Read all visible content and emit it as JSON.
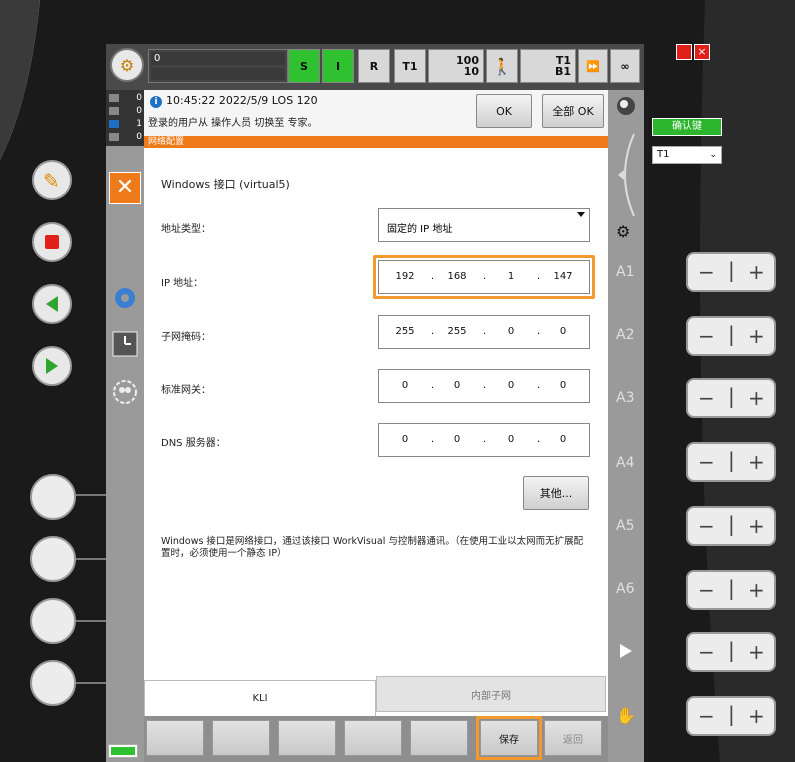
{
  "colors": {
    "accent": "#ef7a1a",
    "highlight": "#f39a2e",
    "status_green": "#2fc12f",
    "confirm_green": "#2db52d",
    "close_red": "#e0201a"
  },
  "status_bar": {
    "program_counter": "0",
    "s_label": "S",
    "i_label": "I",
    "r_label": "R",
    "mode_label": "T1",
    "override_top": "100",
    "override_bottom": "10",
    "tool_top": "T1",
    "tool_bottom": "B1",
    "infinity": "∞"
  },
  "message_counts": [
    "0",
    "0",
    "1",
    "0"
  ],
  "message": {
    "line1": "10:45:22 2022/5/9 LOS 120",
    "line2": "登录的用户从 操作人员 切换至 专家。",
    "ok_label": "OK",
    "all_ok_label": "全部 OK"
  },
  "window_title": "网络配置",
  "form": {
    "heading": "Windows 接口 (virtual5)",
    "address_type_label": "地址类型：",
    "address_type_value": "固定的 IP 地址",
    "ip_label": "IP 地址：",
    "ip": [
      "192",
      "168",
      "1",
      "147"
    ],
    "subnet_label": "子网掩码：",
    "subnet": [
      "255",
      "255",
      "0",
      "0"
    ],
    "gateway_label": "标准网关：",
    "gateway": [
      "0",
      "0",
      "0",
      "0"
    ],
    "dns_label": "DNS 服务器：",
    "dns": [
      "0",
      "0",
      "0",
      "0"
    ],
    "other_button": "其他...",
    "description": "Windows 接口是网络接口，通过该接口 WorkVisual 与控制器通讯。（在使用工业以太网而无扩展配置时，必须使用一个静态 IP）"
  },
  "tabs": {
    "kli": "KLI",
    "internal": "内部子网"
  },
  "softkeys": {
    "save": "保存",
    "back": "返回"
  },
  "axes": [
    "A1",
    "A2",
    "A3",
    "A4",
    "A5",
    "A6"
  ],
  "right_panel": {
    "confirm_label": "确认键",
    "mode_select": "T1"
  }
}
